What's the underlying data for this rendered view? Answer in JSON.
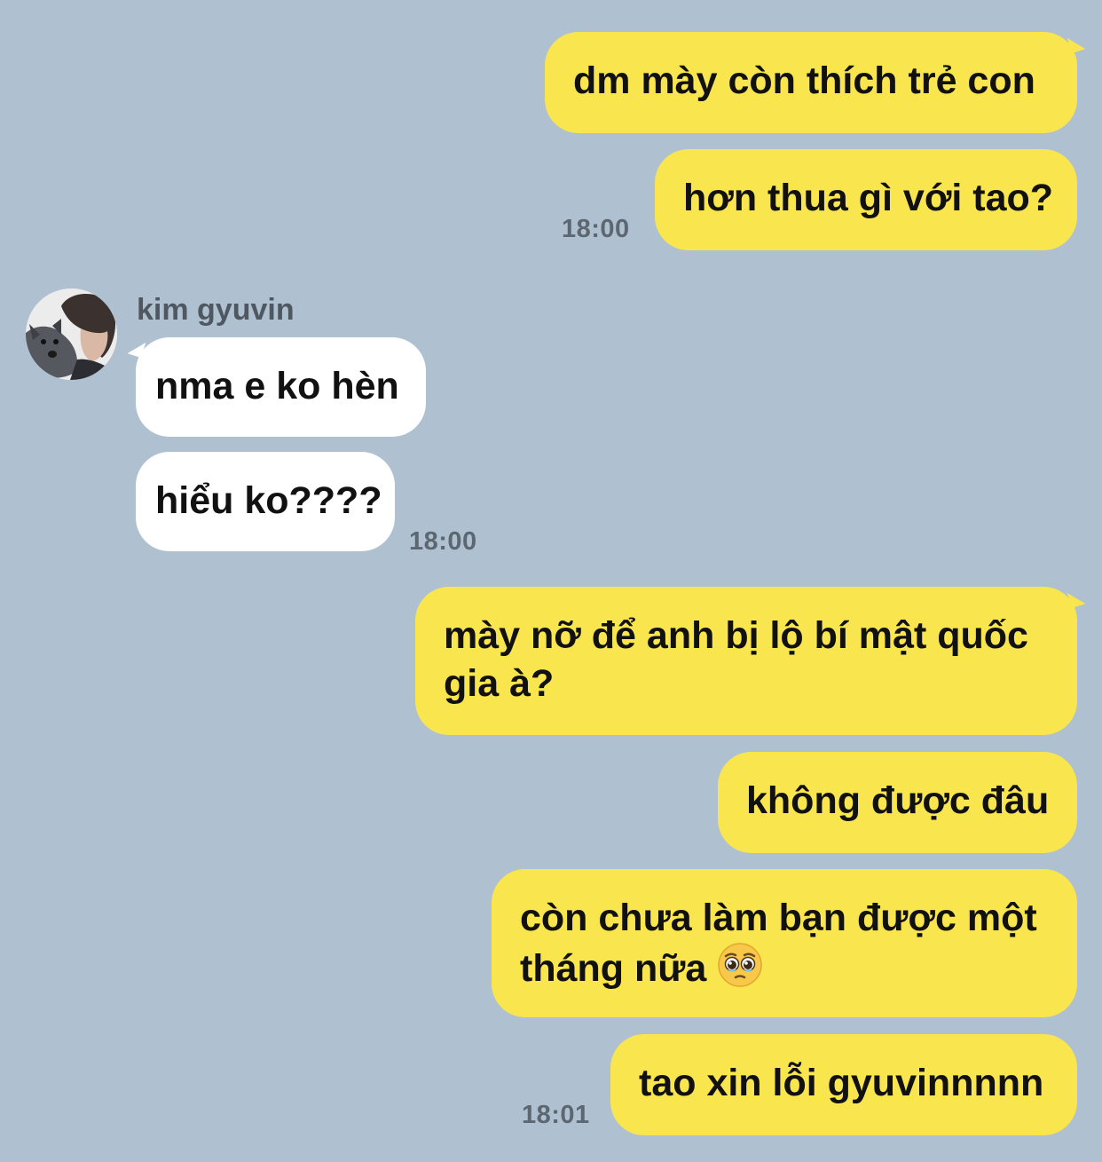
{
  "contact": {
    "name": "kim gyuvin",
    "avatar_icon": "avatar-photo-person-with-dog"
  },
  "colors": {
    "background": "#afc1d1",
    "outgoing_bubble": "#f9e54e",
    "incoming_bubble": "#ffffff",
    "timestamp": "#5d6771"
  },
  "messages": [
    {
      "direction": "outgoing",
      "text": "dm mày còn thích trẻ con"
    },
    {
      "direction": "outgoing",
      "text": "hơn thua gì với tao?",
      "time": "18:00"
    },
    {
      "direction": "incoming",
      "text": "nma e ko hèn"
    },
    {
      "direction": "incoming",
      "text": "hiểu ko????",
      "time": "18:00"
    },
    {
      "direction": "outgoing",
      "text": "mày nỡ để anh bị lộ bí mật quốc gia à?"
    },
    {
      "direction": "outgoing",
      "text": "không được đâu"
    },
    {
      "direction": "outgoing",
      "text": "còn chưa làm bạn được một tháng nữa",
      "emoji": "pleading-face-emoji"
    },
    {
      "direction": "outgoing",
      "text": "tao xin lỗi gyuvinnnnn",
      "time": "18:01"
    }
  ]
}
